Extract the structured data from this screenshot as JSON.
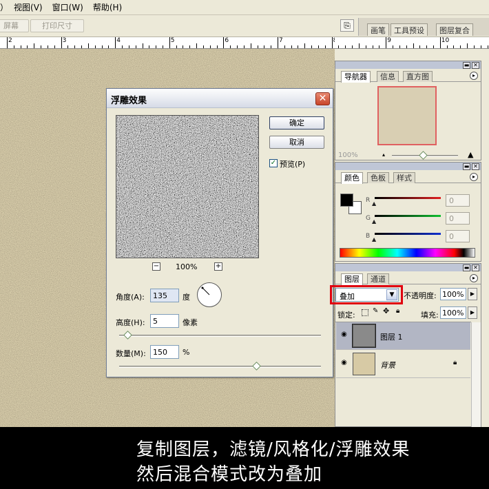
{
  "menu": {
    "items": [
      "）",
      "视图(V)",
      "窗口(W)",
      "帮助(H)"
    ]
  },
  "options_bar": {
    "screen_btn": "屏幕",
    "print_size_btn": "打印尺寸"
  },
  "palette_well": {
    "tabs": [
      "画笔",
      "工具预设",
      "图层复合"
    ]
  },
  "ruler": {
    "labels": [
      "2",
      "3",
      "4",
      "5",
      "6",
      "7",
      "8",
      "9",
      "10"
    ]
  },
  "dialog": {
    "title": "浮雕效果",
    "ok": "确定",
    "cancel": "取消",
    "preview_label": "预览(P)",
    "preview_checked": true,
    "zoom": "100%",
    "zoom_minus": "−",
    "zoom_plus": "+",
    "angle_label": "角度(A):",
    "angle_value": "135",
    "angle_unit": "度",
    "height_label": "高度(H):",
    "height_value": "5",
    "height_unit": "像素",
    "height_slider_fraction": 0.04,
    "amount_label": "数量(M):",
    "amount_value": "150",
    "amount_unit": "%",
    "amount_slider_fraction": 0.68
  },
  "navigator": {
    "tabs": [
      "导航器",
      "信息",
      "直方图"
    ],
    "zoom": "100%"
  },
  "color_panel": {
    "tabs": [
      "颜色",
      "色板",
      "样式"
    ],
    "channels": [
      {
        "label": "R",
        "value": "0",
        "color": "#e02020"
      },
      {
        "label": "G",
        "value": "0",
        "color": "#10c030"
      },
      {
        "label": "B",
        "value": "0",
        "color": "#1030d0"
      }
    ]
  },
  "layers_panel": {
    "tabs": [
      "图层",
      "通道"
    ],
    "blend_mode": "叠加",
    "opacity_label": "不透明度:",
    "opacity_value": "100%",
    "lock_label": "锁定:",
    "fill_label": "填充:",
    "fill_value": "100%",
    "layers": [
      {
        "name": "图层 1",
        "selected": true
      },
      {
        "name": "背景",
        "locked": true
      }
    ]
  },
  "caption": {
    "line1": "复制图层，滤镜/风格化/浮雕效果",
    "line2": "然后混合模式改为叠加"
  },
  "colors": {
    "highlight_box": "#e0000f",
    "canvas": "#d2c6a4",
    "nav_frame": "#e06060"
  }
}
